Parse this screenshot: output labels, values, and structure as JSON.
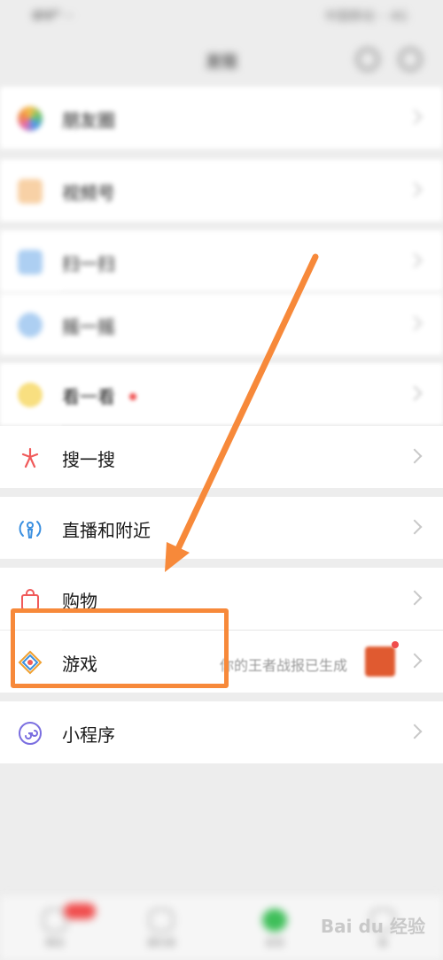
{
  "statusbar": {
    "left": "ΦΨ⁹ ··",
    "right": "中国移动 ·· 4G"
  },
  "header": {
    "title": "发现"
  },
  "rows": [
    {
      "label": "朋友圈",
      "icon": "moments-icon"
    },
    {
      "label": "视频号",
      "icon": "channels-icon"
    },
    {
      "label": "扫一扫",
      "icon": "scan-icon"
    },
    {
      "label": "摇一摇",
      "icon": "shake-icon"
    },
    {
      "label": "看一看",
      "icon": "look-icon"
    },
    {
      "label": "搜一搜",
      "icon": "search-feature-icon"
    },
    {
      "label": "直播和附近",
      "icon": "live-icon"
    },
    {
      "label": "购物",
      "icon": "shopping-bag-icon"
    },
    {
      "label": "游戏",
      "icon": "game-icon",
      "note": "你的王者战报已生成"
    },
    {
      "label": "小程序",
      "icon": "mini-program-icon"
    }
  ],
  "tabs": [
    {
      "label": "微信"
    },
    {
      "label": "通讯录"
    },
    {
      "label": "发现"
    },
    {
      "label": "我"
    }
  ],
  "watermark": "Bai du 经验",
  "colors": {
    "accent": "#f7893a",
    "wechat_green": "#3fbf5a",
    "badge_red": "#f04c4c"
  }
}
